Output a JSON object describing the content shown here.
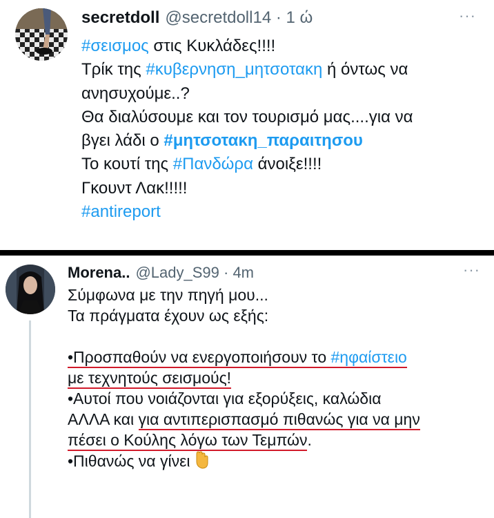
{
  "tweet1": {
    "name": "secretdoll",
    "handle": "@secretdoll14 · 1 ώ",
    "more": "···",
    "l1_tag": "#σεισμος",
    "l1_text": " στις Κυκλάδες!!!!",
    "l2_text": "Τρίκ της ",
    "l2_tag": "#κυβερνηση_μητσοτακη",
    "l2_text2": " ή όντως να",
    "l3_text": "ανησυχούμε..?",
    "l4_text": "Θα διαλύσουμε και τον τουρισμό μας....για να",
    "l5_text": "βγει λάδι ο ",
    "l5_tag": "#μητσοτακη_παραιτησου",
    "l6_text": "Το κουτί της ",
    "l6_tag": "#Πανδώρα",
    "l6_text2": " άνοιξε!!!!",
    "l7_text": "Γκουντ Λακ!!!!!",
    "l8_tag": "#antireport"
  },
  "tweet2": {
    "name": "Morena..",
    "handle": "@Lady_S99 · 4m",
    "more": "···",
    "l1": "Σύμφωνα με την πηγή μου...",
    "l2": "Τα πράγματα έχουν ως εξής:",
    "l3_text": "•Προσπαθούν να ενεργοποιήσουν το ",
    "l3_tag": "#ηφαίστειο",
    "l4": "με τεχνητούς σεισμούς!",
    "l5": "•Αυτοί που νοιάζονται για εξορύξεις, καλώδια",
    "l6_a": "ΑΛΛΑ και ",
    "l6_b": "για αντιπερισπασμό πιθανώς για να μην",
    "l7": "πέσει ο Κούλης λόγω των Τεμπών",
    "l7_end": ".",
    "l8": "•Πιθανώς να γίνει"
  },
  "icons": {
    "avatar1": "avatar-photo",
    "avatar2": "avatar-photo",
    "more": "more-options-icon",
    "emoji": "backhand-index-pointing-down-emoji"
  },
  "colors": {
    "link": "#1d9bf0",
    "secondary": "#536471",
    "underline": "#d11a2a",
    "divider": "#000000"
  }
}
